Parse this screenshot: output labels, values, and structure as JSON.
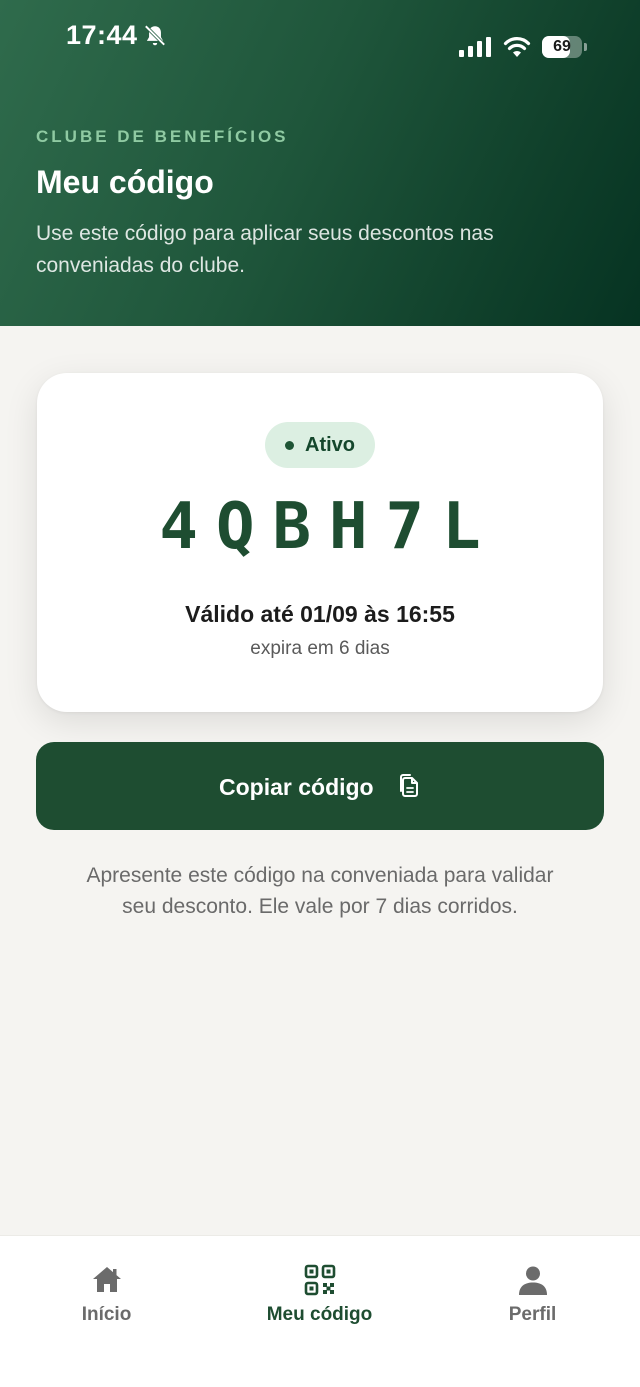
{
  "status_bar": {
    "time": "17:44",
    "battery": "69",
    "battery_level": 0.69
  },
  "header": {
    "eyebrow": "CLUBE DE BENEFÍCIOS",
    "title": "Meu código",
    "description": "Use este código para aplicar seus descontos nas conveniadas do clube."
  },
  "code_card": {
    "status": "Ativo",
    "code": "4QBH7L",
    "valid_until": "Válido até 01/09 às 16:55",
    "expires_in": "expira em 6 dias"
  },
  "copy_button": {
    "label": "Copiar código",
    "icon": "copy-icon"
  },
  "help_text": "Apresente este código na conveniada para validar seu desconto. Ele vale por 7 dias corridos.",
  "bottom_nav": {
    "items": [
      {
        "label": "Início",
        "icon": "home-icon",
        "active": false
      },
      {
        "label": "Meu código",
        "icon": "qr-code-icon",
        "active": true
      },
      {
        "label": "Perfil",
        "icon": "user-icon",
        "active": false
      }
    ]
  },
  "colors": {
    "brand": "#1e4d31",
    "header_gradient_start": "#2f6b4c",
    "header_gradient_end": "#063322",
    "badge_bg": "#dcefe2",
    "background": "#f5f4f1"
  }
}
